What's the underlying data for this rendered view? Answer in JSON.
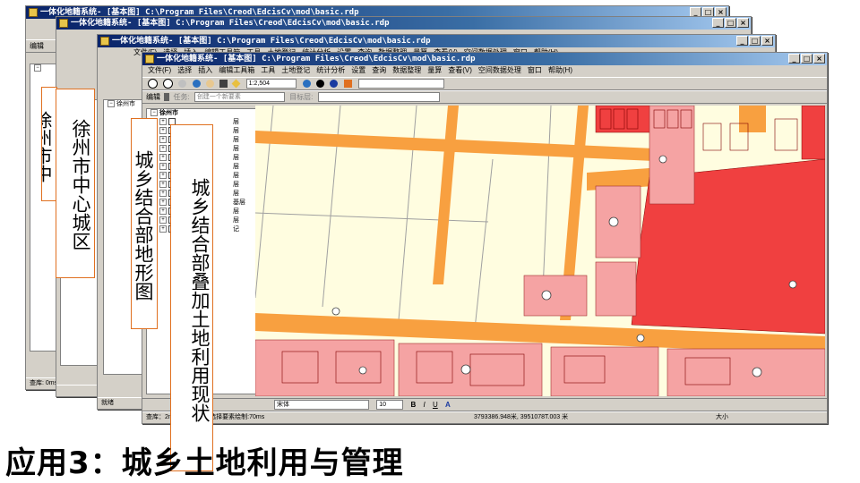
{
  "window_title": "一体化地籍系统- [基本图] C:\\Program Files\\Creod\\EdcisCv\\mod\\basic.rdp",
  "title_buttons": [
    "_",
    "□",
    "×"
  ],
  "menus": {
    "back": [
      "文件(F)",
      "选择",
      "插入",
      "编辑工具箱",
      "工具",
      "土地登记",
      "统计分析",
      "设置",
      "查询",
      "数据整理",
      "量算",
      "查看(V)",
      "空间数据处理",
      "窗口",
      "帮助(H)"
    ],
    "front": [
      "文件(F)",
      "选择",
      "插入",
      "编辑工具箱",
      "工具",
      "土地登记",
      "统计分析",
      "设置",
      "查询",
      "数据整理",
      "量算",
      "查看(V)",
      "空间数据处理",
      "窗口",
      "帮助(H)"
    ]
  },
  "toolbar": {
    "scale_value": "1:2,504",
    "edit_label": "编辑",
    "task_label": "任务:",
    "task_value": "创建一个新要素",
    "target_label": "目标层:"
  },
  "drawing_toolbar": {
    "font_value": "宋体",
    "size_value": "10"
  },
  "layer_tree": {
    "root": "徐州市",
    "items": [
      "层",
      "层",
      "层",
      "层",
      "层",
      "层",
      "点",
      "层",
      "层",
      "层",
      "层",
      "层",
      "层",
      "层",
      "层",
      "价",
      "层",
      "层",
      "层",
      "层",
      "层",
      "层",
      "层",
      "层",
      "层",
      "层",
      "层",
      "层",
      "层",
      "层"
    ],
    "items_front_tail": [
      "层",
      "层",
      "层",
      "层",
      "层",
      "层",
      "层",
      "层",
      "层",
      "基层",
      "层",
      "层",
      "记"
    ]
  },
  "panel_tabs": {
    "display": "显示"
  },
  "status": {
    "ready": "就绪",
    "query_time_back": "查库: 0ms,",
    "query_time": "查库：2ms,查库:70ms,选择要素绘制:70ms",
    "coordinates": "3793386.948米, 3951078T.003 米",
    "size_label": "大小"
  },
  "callouts": {
    "center": "徐州市中心城区",
    "mid": "城乡结合部地形图",
    "front": "城乡结合部叠加土地利用现状",
    "back": "徐州市中"
  },
  "caption": "应用3：城乡土地利用与管理",
  "colors": {
    "title_dark": "#0a246a",
    "title_light": "#a6caf0",
    "chrome": "#d4d0c8",
    "map_red": "#f04040",
    "map_pink": "#f5a3a3",
    "map_orange": "#f8a040",
    "map_yellow": "#fffde0",
    "callout_border": "#e07020"
  }
}
